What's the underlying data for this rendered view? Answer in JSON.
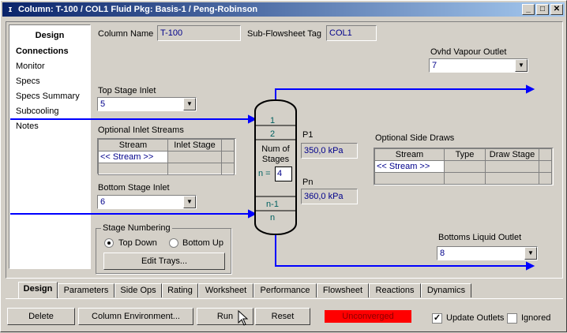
{
  "window": {
    "title": "Column: T-100 / COL1  Fluid Pkg: Basis-1 / Peng-Robinson",
    "minimize": "_",
    "maximize": "□",
    "close": "✕"
  },
  "nav": {
    "header": "Design",
    "items": [
      "Connections",
      "Monitor",
      "Specs",
      "Specs Summary",
      "Subcooling",
      "Notes"
    ]
  },
  "form": {
    "column_name_label": "Column Name",
    "column_name_value": "T-100",
    "subflowsheet_label": "Sub-Flowsheet Tag",
    "subflowsheet_value": "COL1",
    "ovhd_label": "Ovhd Vapour Outlet",
    "ovhd_value": "7",
    "top_inlet_label": "Top Stage Inlet",
    "top_inlet_value": "5",
    "optional_inlets_label": "Optional Inlet Streams",
    "inlet_col_stream": "Stream",
    "inlet_col_stage": "Inlet Stage",
    "inlet_placeholder": "<< Stream >>",
    "bottom_inlet_label": "Bottom Stage Inlet",
    "bottom_inlet_value": "6",
    "stage_numbering_label": "Stage Numbering",
    "top_down": "Top Down",
    "bottom_up": "Bottom Up",
    "edit_trays": "Edit Trays...",
    "p1_label": "P1",
    "p1_value": "350,0 kPa",
    "pn_label": "Pn",
    "pn_value": "360,0 kPa",
    "side_draws_label": "Optional Side Draws",
    "side_col_stream": "Stream",
    "side_col_type": "Type",
    "side_col_stage": "Draw Stage",
    "side_placeholder": "<< Stream >>",
    "bottoms_label": "Bottoms Liquid Outlet",
    "bottoms_value": "8"
  },
  "column": {
    "stage1": "1",
    "stage2": "2",
    "num_stages_label": "Num of Stages",
    "n_equals": "n =",
    "n_value": "4",
    "stage_n1": "n-1",
    "stage_n": "n"
  },
  "tabs": [
    "Design",
    "Parameters",
    "Side Ops",
    "Rating",
    "Worksheet",
    "Performance",
    "Flowsheet",
    "Reactions",
    "Dynamics"
  ],
  "bottom": {
    "delete": "Delete",
    "column_env": "Column Environment...",
    "run": "Run",
    "reset": "Reset",
    "status": "Unconverged",
    "update_outlets": "Update Outlets",
    "ignored": "Ignored"
  },
  "colors": {
    "status_bg": "#ff0000",
    "stream_line": "#0000ff",
    "value_text": "#00008b"
  }
}
